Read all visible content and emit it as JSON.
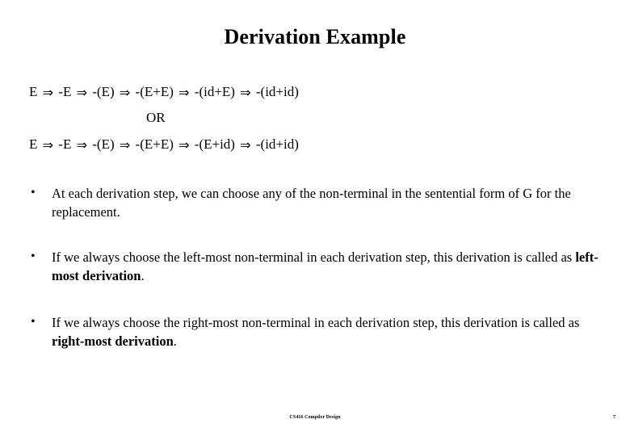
{
  "slide": {
    "title": "Derivation Example",
    "background_color": "#ffffff",
    "text_color": "#000000"
  },
  "derivations": {
    "separator_label": "OR",
    "arrow_glyph": "⇒",
    "lines": [
      {
        "name": "left-most-derivation-line",
        "steps": [
          "E",
          "-E",
          "-(E)",
          "-(E+E)",
          "-(id+E)",
          "-(id+id)"
        ],
        "text": "E ⇒ -E ⇒ -(E) ⇒ -(E+E) ⇒ -(id+E) ⇒ -(id+id)"
      },
      {
        "name": "right-most-derivation-line",
        "steps": [
          "E",
          "-E",
          "-(E)",
          "-(E+E)",
          "-(E+id)",
          "-(id+id)"
        ],
        "text": "E ⇒ -E ⇒ -(E) ⇒ -(E+E) ⇒ -(E+id) ⇒ -(id+id)"
      }
    ]
  },
  "bullets": {
    "marker": "•",
    "items": [
      {
        "name": "bullet-any-nonterminal",
        "segments": [
          {
            "text": "At each derivation step, we can choose any of the non-terminal in the sentential form of G for the replacement.",
            "bold": false
          }
        ]
      },
      {
        "name": "bullet-left-most",
        "segments": [
          {
            "text": "If we always choose the left-most non-terminal in each derivation step, this derivation is called as ",
            "bold": false
          },
          {
            "text": "left-most derivation",
            "bold": true
          },
          {
            "text": ".",
            "bold": false
          }
        ]
      },
      {
        "name": "bullet-right-most",
        "segments": [
          {
            "text": "If we always choose the right-most non-terminal in each derivation step, this derivation is called as ",
            "bold": false
          },
          {
            "text": "right-most derivation",
            "bold": true
          },
          {
            "text": ".",
            "bold": false
          }
        ]
      }
    ]
  },
  "footer": {
    "course_label": "CS416 Compiler Design",
    "page_number": "7"
  }
}
